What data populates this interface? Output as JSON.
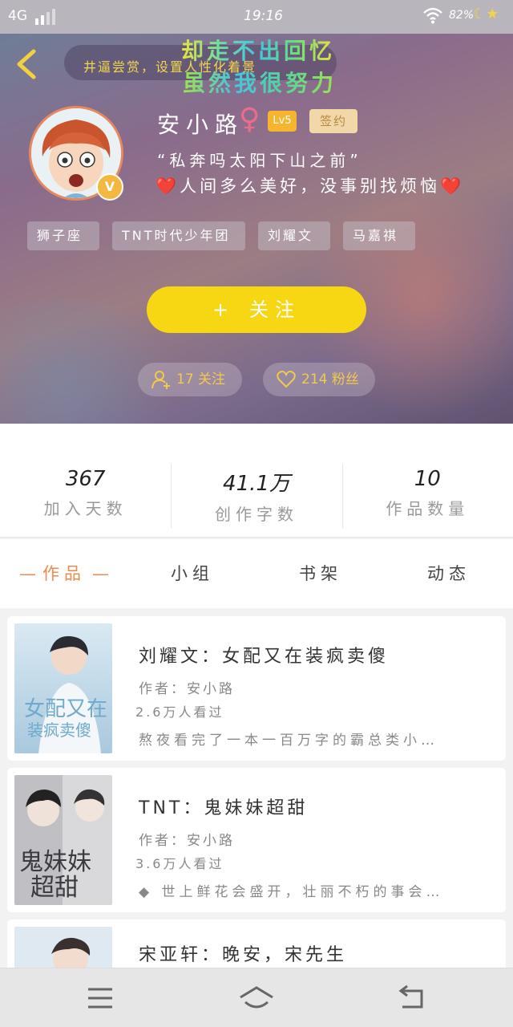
{
  "status": {
    "network": "4G",
    "time": "19:16",
    "battery": "82%"
  },
  "header": {
    "banner_text": "井逼尝赏，设置人性化着景",
    "overlay_line1": "却走不出回忆",
    "overlay_line2": "虽然我很努力",
    "username": "安小路",
    "gender_symbol": "♀",
    "level": "Lv5",
    "sign_badge": "签约",
    "vip_badge": "V",
    "quote_line1": "“私奔吗太阳下山之前”",
    "quote_line2": "❤️人间多么美好，没事别找烦恼❤️",
    "tags": [
      "狮子座",
      "TNT时代少年团",
      "刘耀文",
      "马嘉祺"
    ],
    "follow_label": "关注",
    "follow_plus": "+",
    "following": "17 关注",
    "fans": "214 粉丝"
  },
  "stats": [
    {
      "value": "367",
      "label": "加入天数"
    },
    {
      "value": "41.1万",
      "label": "创作字数"
    },
    {
      "value": "10",
      "label": "作品数量"
    }
  ],
  "tabs": [
    "作品",
    "小组",
    "书架",
    "动态"
  ],
  "works": [
    {
      "title": "刘耀文：女配又在装疯卖傻",
      "author": "作者：安小路",
      "views": "2.6万人看过",
      "desc": "熬夜看完了一本一百万字的霸总类小…"
    },
    {
      "title": "TNT：鬼妹妹超甜",
      "author": "作者：安小路",
      "views": "3.6万人看过",
      "desc": "◆ 世上鲜花会盛开，壮丽不朽的事会…"
    },
    {
      "title": "宋亚轩：晚安，宋先生",
      "author": "",
      "views": "",
      "desc": ""
    }
  ],
  "icons": {
    "back": "chevron-left-icon",
    "menu": "menu-icon",
    "home": "home-icon",
    "return": "return-icon"
  },
  "colors": {
    "accent_yellow": "#f7d613",
    "tab_active": "#f08a4b",
    "pill_text": "#f3c94b"
  }
}
